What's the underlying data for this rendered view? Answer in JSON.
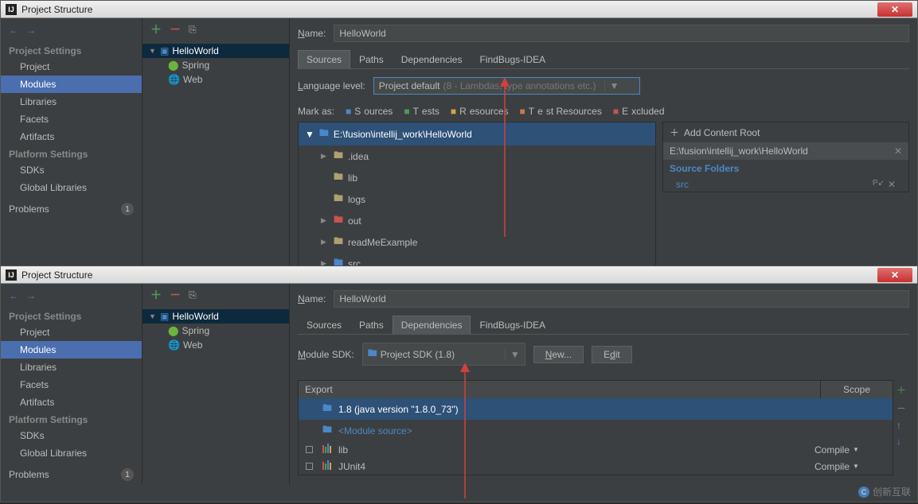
{
  "top": {
    "title": "Project Structure",
    "sidebar": {
      "projectSettings": "Project Settings",
      "items": [
        "Project",
        "Modules",
        "Libraries",
        "Facets",
        "Artifacts"
      ],
      "platformSettings": "Platform Settings",
      "platItems": [
        "SDKs",
        "Global Libraries"
      ],
      "problems": "Problems",
      "problemsCount": "1"
    },
    "tree": {
      "root": "HelloWorld",
      "children": [
        "Spring",
        "Web"
      ]
    },
    "main": {
      "nameLabel": "Name:",
      "nameValue": "HelloWorld",
      "tabs": [
        "Sources",
        "Paths",
        "Dependencies",
        "FindBugs-IDEA"
      ],
      "langLabel": "Language level:",
      "langValue": "Project default",
      "langDim": "(8 - Lambdas, type annotations etc.)",
      "markAs": "Mark as:",
      "marks": {
        "sources": "Sources",
        "tests": "Tests",
        "resources": "Resources",
        "testResources": "Test Resources",
        "excluded": "Excluded"
      },
      "srcRoot": "E:\\fusion\\intellij_work\\HelloWorld",
      "srcFolders": [
        ".idea",
        "lib",
        "logs",
        "out",
        "readMeExample",
        "src"
      ],
      "addContentRoot": "Add Content Root",
      "contentPath": "E:\\fusion\\intellij_work\\HelloWorld",
      "sourceFolders": "Source Folders",
      "srcItem": "src"
    }
  },
  "bottom": {
    "title": "Project Structure",
    "sidebar": {
      "projectSettings": "Project Settings",
      "items": [
        "Project",
        "Modules",
        "Libraries",
        "Facets",
        "Artifacts"
      ],
      "platformSettings": "Platform Settings",
      "platItems": [
        "SDKs",
        "Global Libraries"
      ],
      "problems": "Problems",
      "problemsCount": "1"
    },
    "tree": {
      "root": "HelloWorld",
      "children": [
        "Spring",
        "Web"
      ]
    },
    "main": {
      "nameLabel": "Name:",
      "nameValue": "HelloWorld",
      "tabs": [
        "Sources",
        "Paths",
        "Dependencies",
        "FindBugs-IDEA"
      ],
      "sdkLabel": "Module SDK:",
      "sdkValue": "Project SDK (1.8)",
      "newBtn": "New...",
      "editBtn": "Edit",
      "exportHdr": "Export",
      "scopeHdr": "Scope",
      "deps": [
        {
          "name": "1.8 (java version \"1.8.0_73\")",
          "scope": "",
          "sel": true,
          "icon": "folder"
        },
        {
          "name": "<Module source>",
          "scope": "",
          "sel": false,
          "icon": "folder"
        },
        {
          "name": "lib",
          "scope": "Compile",
          "sel": false,
          "icon": "lib"
        },
        {
          "name": "JUnit4",
          "scope": "Compile",
          "sel": false,
          "icon": "lib"
        }
      ]
    }
  },
  "watermark": "创新互联"
}
